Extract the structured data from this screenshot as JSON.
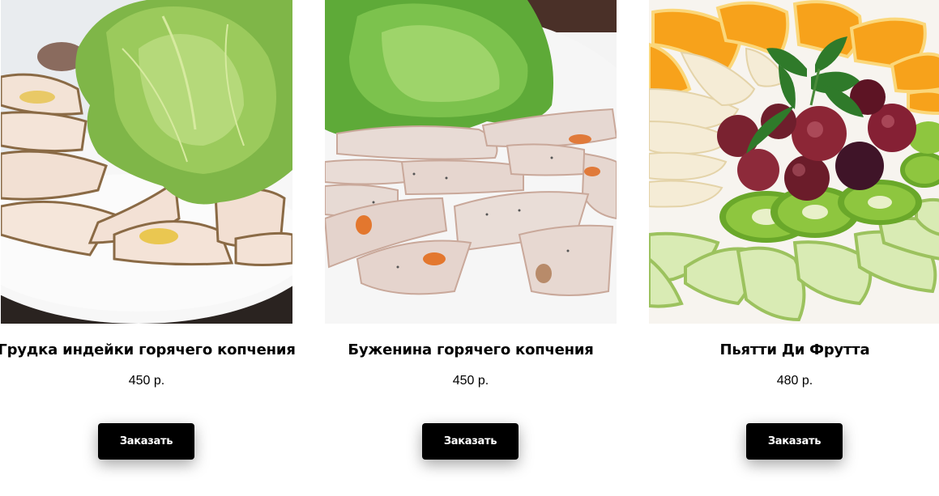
{
  "products": [
    {
      "image": "turkey-breast-salad-photo",
      "title": "Грудка индейки горячего копчения",
      "price": "450 р.",
      "button_label": "Заказать"
    },
    {
      "image": "boiled-pork-photo",
      "title": "Буженина горячего копчения",
      "price": "450 р.",
      "button_label": "Заказать"
    },
    {
      "image": "fruit-plate-photo",
      "title": "Пьятти Ди Фрутта",
      "price": "480 р.",
      "button_label": "Заказать"
    }
  ],
  "colors": {
    "button_bg": "#000000",
    "button_text": "#ffffff",
    "text": "#000000",
    "background": "#ffffff"
  }
}
